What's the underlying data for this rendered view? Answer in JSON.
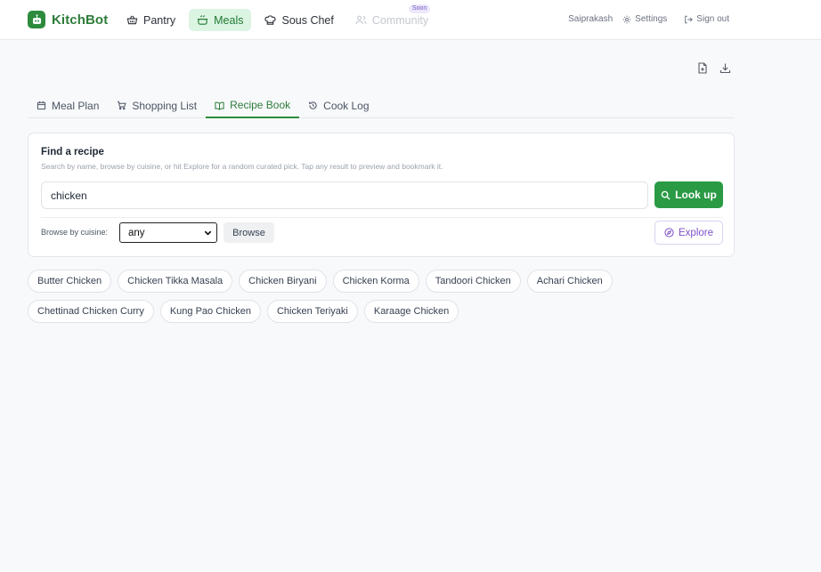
{
  "app": {
    "name": "KitchBot",
    "brand_color": "#2e8b3e"
  },
  "nav": {
    "items": [
      {
        "label": "Pantry",
        "icon": "basket-icon",
        "state": "normal"
      },
      {
        "label": "Meals",
        "icon": "pot-icon",
        "state": "active"
      },
      {
        "label": "Sous Chef",
        "icon": "chef-hat-icon",
        "state": "normal"
      },
      {
        "label": "Community",
        "icon": "users-icon",
        "state": "disabled",
        "badge": "Soon"
      }
    ]
  },
  "user": {
    "name": "Saiprakash",
    "settings_label": "Settings",
    "signout_label": "Sign out"
  },
  "page_actions": [
    {
      "icon": "export-file-icon"
    },
    {
      "icon": "download-icon"
    }
  ],
  "tabs": [
    {
      "label": "Meal Plan",
      "icon": "calendar-icon",
      "active": false
    },
    {
      "label": "Shopping List",
      "icon": "cart-icon",
      "active": false
    },
    {
      "label": "Recipe Book",
      "icon": "open-book-icon",
      "active": true
    },
    {
      "label": "Cook Log",
      "icon": "history-icon",
      "active": false
    }
  ],
  "finder": {
    "title": "Find a recipe",
    "subtitle": "Search by name, browse by cuisine, or hit Explore for a random curated pick. Tap any result to preview and bookmark it.",
    "search_value": "chicken",
    "lookup_label": "Look up",
    "browse_label": "Browse by cuisine:",
    "cuisine_selected": "any",
    "browse_button": "Browse",
    "explore_button": "Explore"
  },
  "results": [
    "Butter Chicken",
    "Chicken Tikka Masala",
    "Chicken Biryani",
    "Chicken Korma",
    "Tandoori Chicken",
    "Achari Chicken",
    "Chettinad Chicken Curry",
    "Kung Pao Chicken",
    "Chicken Teriyaki",
    "Karaage Chicken"
  ]
}
